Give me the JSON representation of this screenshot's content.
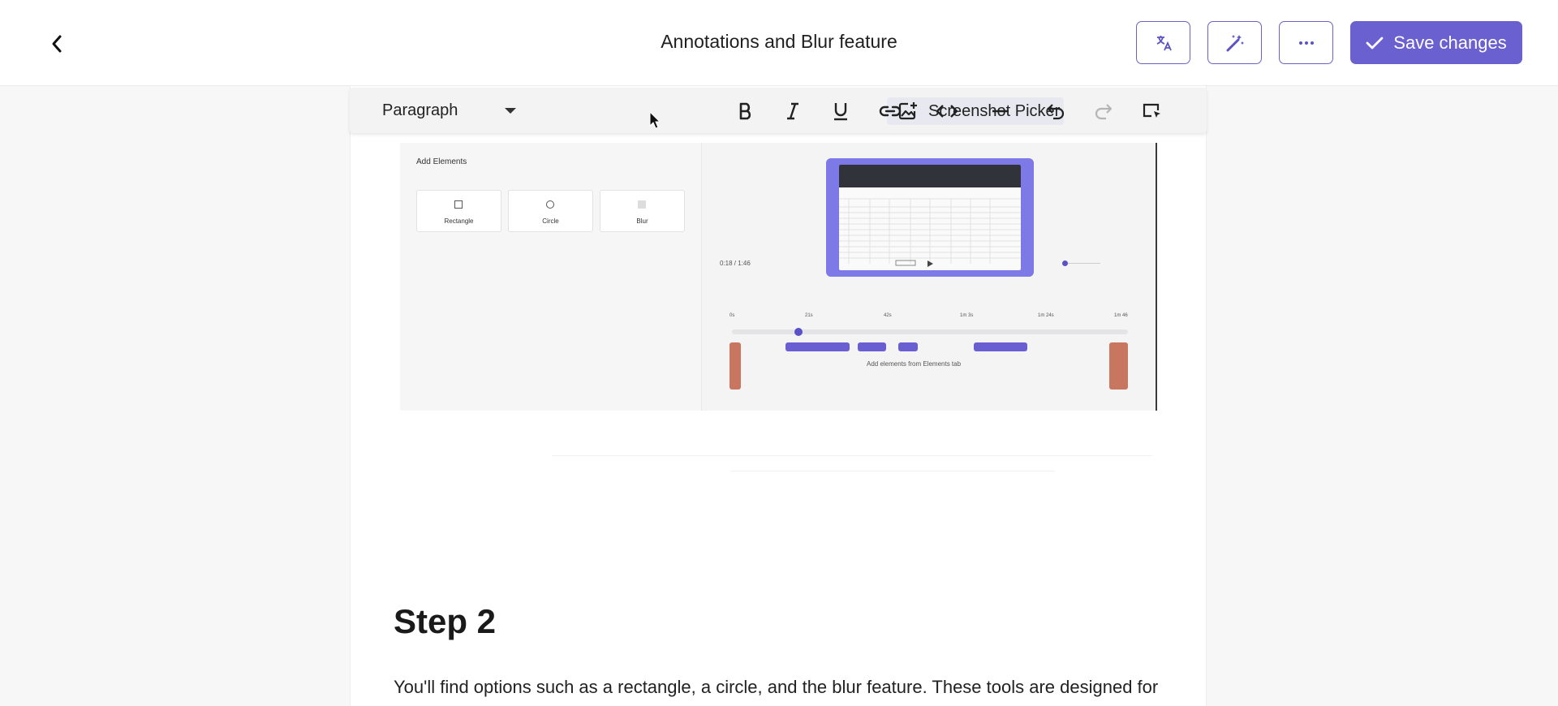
{
  "header": {
    "title": "Annotations and Blur feature",
    "save_label": "Save changes",
    "icons": [
      "chevron-left-icon",
      "translate-icon",
      "magic-wand-icon",
      "more-horizontal-icon",
      "checkmark-icon"
    ]
  },
  "toolbar": {
    "block_type": "Paragraph",
    "picker_label": "Screenshot Picker",
    "icons": [
      "image-add-icon",
      "bold-icon",
      "italic-icon",
      "underline-icon",
      "link-icon",
      "code-icon",
      "horizontal-rule-icon",
      "undo-icon",
      "redo-icon",
      "select-element-icon"
    ]
  },
  "screenshot": {
    "panel_title": "Add Elements",
    "elements": [
      "Rectangle",
      "Circle",
      "Blur"
    ],
    "time": "0:18 / 1:46",
    "hint": "Add elements from Elements tab",
    "ticks": [
      "0s",
      "21s",
      "42s",
      "1m 3s",
      "1m 24s",
      "1m 46"
    ]
  },
  "content": {
    "step_heading": "Step 2",
    "body": "You'll find options such as a rectangle, a circle, and the blur feature. These tools are designed for"
  },
  "colors": {
    "accent": "#6b60cf",
    "accent_border": "#6a62c9",
    "timeline_segment": "#6a5fd2",
    "timeline_handle": "#c8765f"
  }
}
